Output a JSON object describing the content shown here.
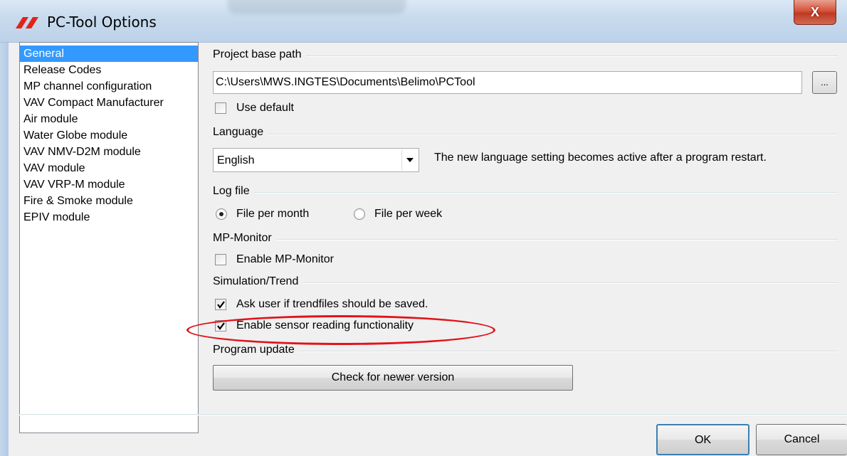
{
  "window": {
    "title": "PC-Tool Options",
    "close_label": "X"
  },
  "nav": {
    "items": [
      {
        "label": "General",
        "selected": true
      },
      {
        "label": "Release Codes",
        "selected": false
      },
      {
        "label": "MP channel configuration",
        "selected": false
      },
      {
        "label": "VAV Compact Manufacturer",
        "selected": false
      },
      {
        "label": "Air module",
        "selected": false
      },
      {
        "label": "Water Globe module",
        "selected": false
      },
      {
        "label": "VAV NMV-D2M module",
        "selected": false
      },
      {
        "label": "VAV module",
        "selected": false
      },
      {
        "label": "VAV VRP-M module",
        "selected": false
      },
      {
        "label": "Fire & Smoke module",
        "selected": false
      },
      {
        "label": "EPIV module",
        "selected": false
      }
    ]
  },
  "project_base_path": {
    "label": "Project base path",
    "value": "C:\\Users\\MWS.INGTES\\Documents\\Belimo\\PCTool",
    "browse_label": "...",
    "use_default_label": "Use default",
    "use_default_checked": false
  },
  "language": {
    "label": "Language",
    "selected": "English",
    "note": "The new language setting becomes active after a program restart."
  },
  "log_file": {
    "label": "Log file",
    "options": [
      {
        "label": "File per month",
        "selected": true
      },
      {
        "label": "File per week",
        "selected": false
      }
    ]
  },
  "mp_monitor": {
    "label": "MP-Monitor",
    "enable_label": "Enable MP-Monitor",
    "enable_checked": false
  },
  "simulation_trend": {
    "label": "Simulation/Trend",
    "ask_save_label": "Ask user if trendfiles should be saved.",
    "ask_save_checked": true,
    "sensor_reading_label": "Enable sensor reading functionality",
    "sensor_reading_checked": true
  },
  "program_update": {
    "label": "Program update",
    "check_button_label": "Check for newer version"
  },
  "dialog_buttons": {
    "ok_label": "OK",
    "cancel_label": "Cancel"
  },
  "colors": {
    "selection": "#3399ff",
    "annotation": "#e0141c",
    "close_button": "#c03a22"
  }
}
